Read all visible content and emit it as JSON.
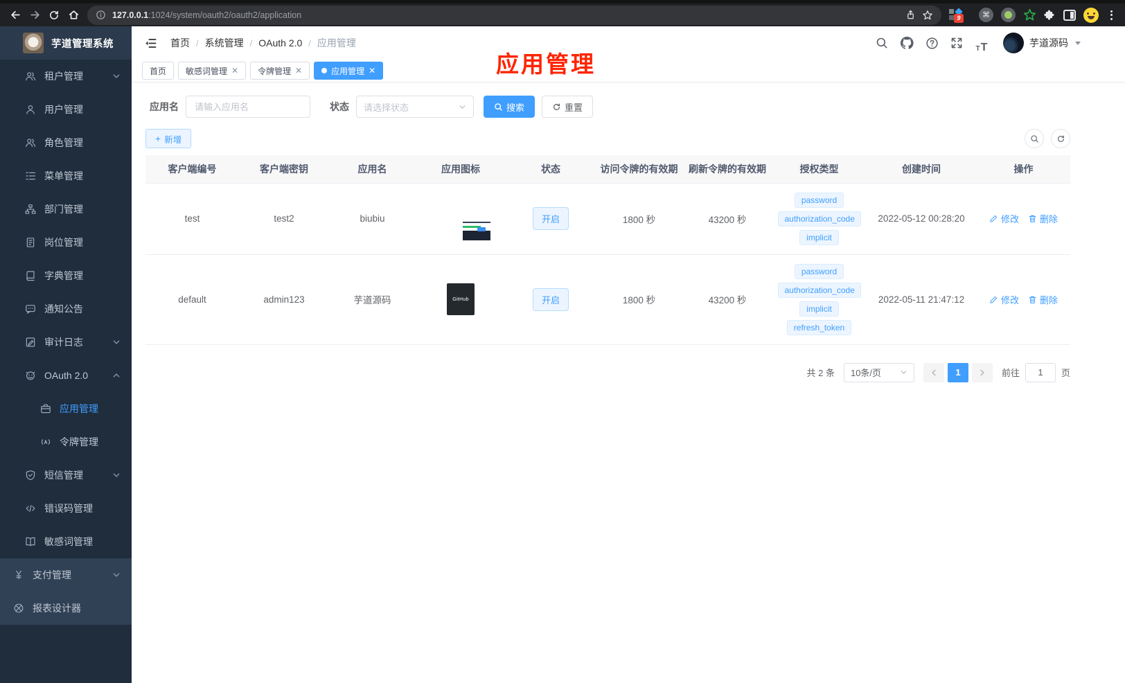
{
  "browser": {
    "url_host": "127.0.0.1",
    "url_rest": ":1024/system/oauth2/oauth2/application",
    "extension_badge": "9",
    "extension_icons": [
      "extensions-grid-icon",
      "gem-icon",
      "command-circle-icon",
      "green-dot-circle-icon",
      "green-star-icon",
      "puzzle-icon",
      "side-panel-icon",
      "profile-emoji-icon",
      "menu-dots-icon"
    ]
  },
  "sidebar": {
    "logo_title": "芋道管理系统",
    "items": [
      {
        "label": "租户管理",
        "icon": "users-icon",
        "chevron": "down"
      },
      {
        "label": "用户管理",
        "icon": "user-icon"
      },
      {
        "label": "角色管理",
        "icon": "users-icon"
      },
      {
        "label": "菜单管理",
        "icon": "menu-tree-icon"
      },
      {
        "label": "部门管理",
        "icon": "org-tree-icon"
      },
      {
        "label": "岗位管理",
        "icon": "id-badge-icon"
      },
      {
        "label": "字典管理",
        "icon": "book-icon"
      },
      {
        "label": "通知公告",
        "icon": "message-icon"
      },
      {
        "label": "审计日志",
        "icon": "audit-log-icon",
        "chevron": "down"
      },
      {
        "label": "OAuth 2.0",
        "icon": "robot-icon",
        "chevron": "up"
      },
      {
        "label": "应用管理",
        "icon": "briefcase-icon",
        "active": true
      },
      {
        "label": "令牌管理",
        "icon": "token-icon"
      },
      {
        "label": "短信管理",
        "icon": "shield-check-icon",
        "chevron": "down"
      },
      {
        "label": "错误码管理",
        "icon": "code-icon"
      },
      {
        "label": "敏感词管理",
        "icon": "book-open-icon"
      },
      {
        "label": "支付管理",
        "icon": "yen-icon",
        "chevron": "down"
      },
      {
        "label": "报表设计器",
        "icon": "report-wheel-icon"
      }
    ]
  },
  "header": {
    "breadcrumb": [
      "首页",
      "系统管理",
      "OAuth 2.0",
      "应用管理"
    ],
    "icons": [
      "search-icon",
      "github-icon",
      "help-icon",
      "fullscreen-icon",
      "font-size-icon"
    ],
    "user_name": "芋道源码"
  },
  "annotation": {
    "text": "应用管理"
  },
  "tabs": [
    {
      "label": "首页",
      "closable": false,
      "active": false
    },
    {
      "label": "敏感词管理",
      "closable": true,
      "active": false
    },
    {
      "label": "令牌管理",
      "closable": true,
      "active": false
    },
    {
      "label": "应用管理",
      "closable": true,
      "active": true
    }
  ],
  "filters": {
    "name_label": "应用名",
    "name_placeholder": "请输入应用名",
    "status_label": "状态",
    "status_placeholder": "请选择状态",
    "search_label": "搜索",
    "reset_label": "重置"
  },
  "toolbar": {
    "add_label": "新增"
  },
  "table": {
    "headers": [
      "客户端编号",
      "客户端密钥",
      "应用名",
      "应用图标",
      "状态",
      "访问令牌的有效期",
      "刷新令牌的有效期",
      "授权类型",
      "创建时间",
      "操作"
    ],
    "edit_label": "修改",
    "delete_label": "删除",
    "rows": [
      {
        "client_id": "test",
        "client_secret": "test2",
        "app_name": "biubiu",
        "app_icon": "dashboard-screenshot",
        "status": "开启",
        "access_token_validity": "1800 秒",
        "refresh_token_validity": "43200 秒",
        "grants": [
          "password",
          "authorization_code",
          "implicit"
        ],
        "created_at": "2022-05-12 00:28:20"
      },
      {
        "client_id": "default",
        "client_secret": "admin123",
        "app_name": "芋道源码",
        "app_icon": "github-logo",
        "app_icon_text": "GitHub",
        "status": "开启",
        "access_token_validity": "1800 秒",
        "refresh_token_validity": "43200 秒",
        "grants": [
          "password",
          "authorization_code",
          "implicit",
          "refresh_token"
        ],
        "created_at": "2022-05-11 21:47:12"
      }
    ]
  },
  "pagination": {
    "total": "共 2 条",
    "page_size": "10条/页",
    "current_page": "1",
    "goto_label": "前往",
    "goto_value": "1",
    "page_unit": "页"
  },
  "colors": {
    "primary": "#409eff",
    "annotation": "#ff2400",
    "sidebar_bg": "#1f2d3d",
    "sidebar_top_bg": "#304156"
  }
}
